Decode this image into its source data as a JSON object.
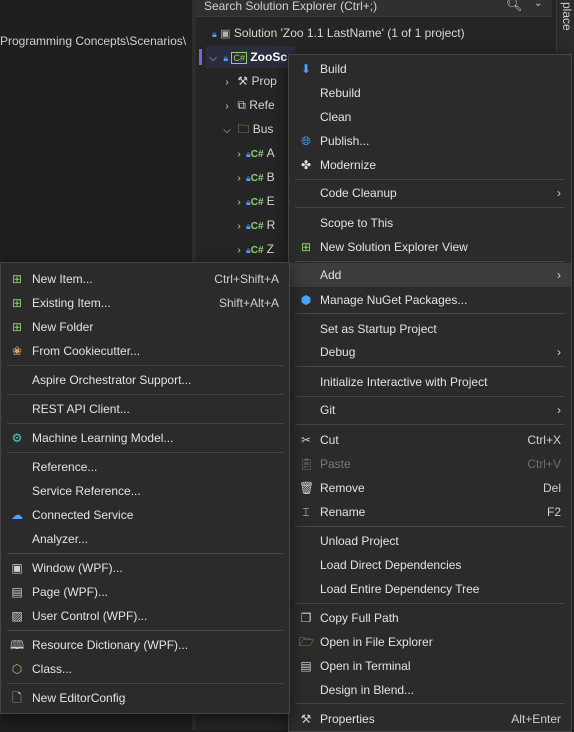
{
  "background": {
    "path_text": "Programming Concepts\\Scenarios\\",
    "search_placeholder": "Search Solution Explorer (Ctrl+;)",
    "right_tab": "place"
  },
  "tree": {
    "solution_label": "Solution 'Zoo 1.1 LastName' (1 of 1 project)",
    "project_label": "ZooSc",
    "properties_label": "Prop",
    "references_label": "Refe",
    "business_label": "Bus",
    "cs_items": [
      "A",
      "B",
      "E",
      "R",
      "Z"
    ]
  },
  "context_menu": {
    "items": {
      "build": "Build",
      "rebuild": "Rebuild",
      "clean": "Clean",
      "publish": "Publish...",
      "modernize": "Modernize",
      "code_cleanup": "Code Cleanup",
      "scope_to_this": "Scope to This",
      "new_se_view": "New Solution Explorer View",
      "add": "Add",
      "manage_nuget": "Manage NuGet Packages...",
      "set_startup": "Set as Startup Project",
      "debug": "Debug",
      "init_interactive": "Initialize Interactive with Project",
      "git": "Git",
      "cut": "Cut",
      "cut_sc": "Ctrl+X",
      "paste": "Paste",
      "paste_sc": "Ctrl+V",
      "remove": "Remove",
      "remove_sc": "Del",
      "rename": "Rename",
      "rename_sc": "F2",
      "unload": "Unload Project",
      "load_direct": "Load Direct Dependencies",
      "load_tree": "Load Entire Dependency Tree",
      "copy_path": "Copy Full Path",
      "open_explorer": "Open in File Explorer",
      "open_terminal": "Open in Terminal",
      "design_blend": "Design in Blend...",
      "properties": "Properties",
      "properties_sc": "Alt+Enter"
    }
  },
  "add_submenu": {
    "items": {
      "new_item": "New Item...",
      "new_item_sc": "Ctrl+Shift+A",
      "existing_item": "Existing Item...",
      "existing_item_sc": "Shift+Alt+A",
      "new_folder": "New Folder",
      "cookiecutter": "From Cookiecutter...",
      "aspire": "Aspire Orchestrator Support...",
      "rest_api": "REST API Client...",
      "ml_model": "Machine Learning Model...",
      "reference": "Reference...",
      "service_reference": "Service Reference...",
      "connected_service": "Connected Service",
      "analyzer": "Analyzer...",
      "window_wpf": "Window (WPF)...",
      "page_wpf": "Page (WPF)...",
      "user_control_wpf": "User Control (WPF)...",
      "resource_dict_wpf": "Resource Dictionary (WPF)...",
      "class": "Class...",
      "new_editorconfig": "New EditorConfig"
    }
  },
  "colors": {
    "menu_bg": "#2b2b2b",
    "highlight": "#3c3c3c",
    "accent_purple": "#7a63d8",
    "accent_blue": "#4aa3ff",
    "csharp_green": "#8fd16a"
  }
}
